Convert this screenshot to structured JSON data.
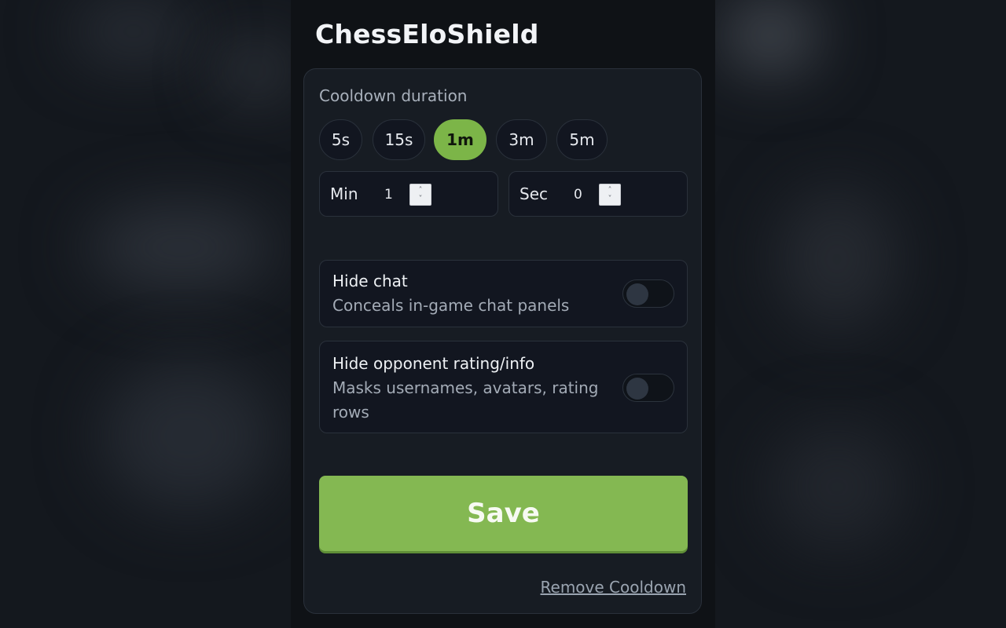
{
  "app": {
    "title": "ChessEloShield"
  },
  "cooldown": {
    "label": "Cooldown duration",
    "presets": [
      "5s",
      "15s",
      "1m",
      "3m",
      "5m"
    ],
    "selected": "1m",
    "min": {
      "label": "Min",
      "value": "1"
    },
    "sec": {
      "label": "Sec",
      "value": "0"
    }
  },
  "toggles": [
    {
      "title": "Hide chat",
      "description": "Conceals in-game chat panels",
      "on": false
    },
    {
      "title": "Hide opponent rating/info",
      "description": "Masks usernames, avatars, rating rows",
      "on": false
    }
  ],
  "actions": {
    "save": "Save",
    "remove": "Remove Cooldown"
  },
  "colors": {
    "accent": "#84b852",
    "background": "#0f1216",
    "card": "#171c23"
  }
}
